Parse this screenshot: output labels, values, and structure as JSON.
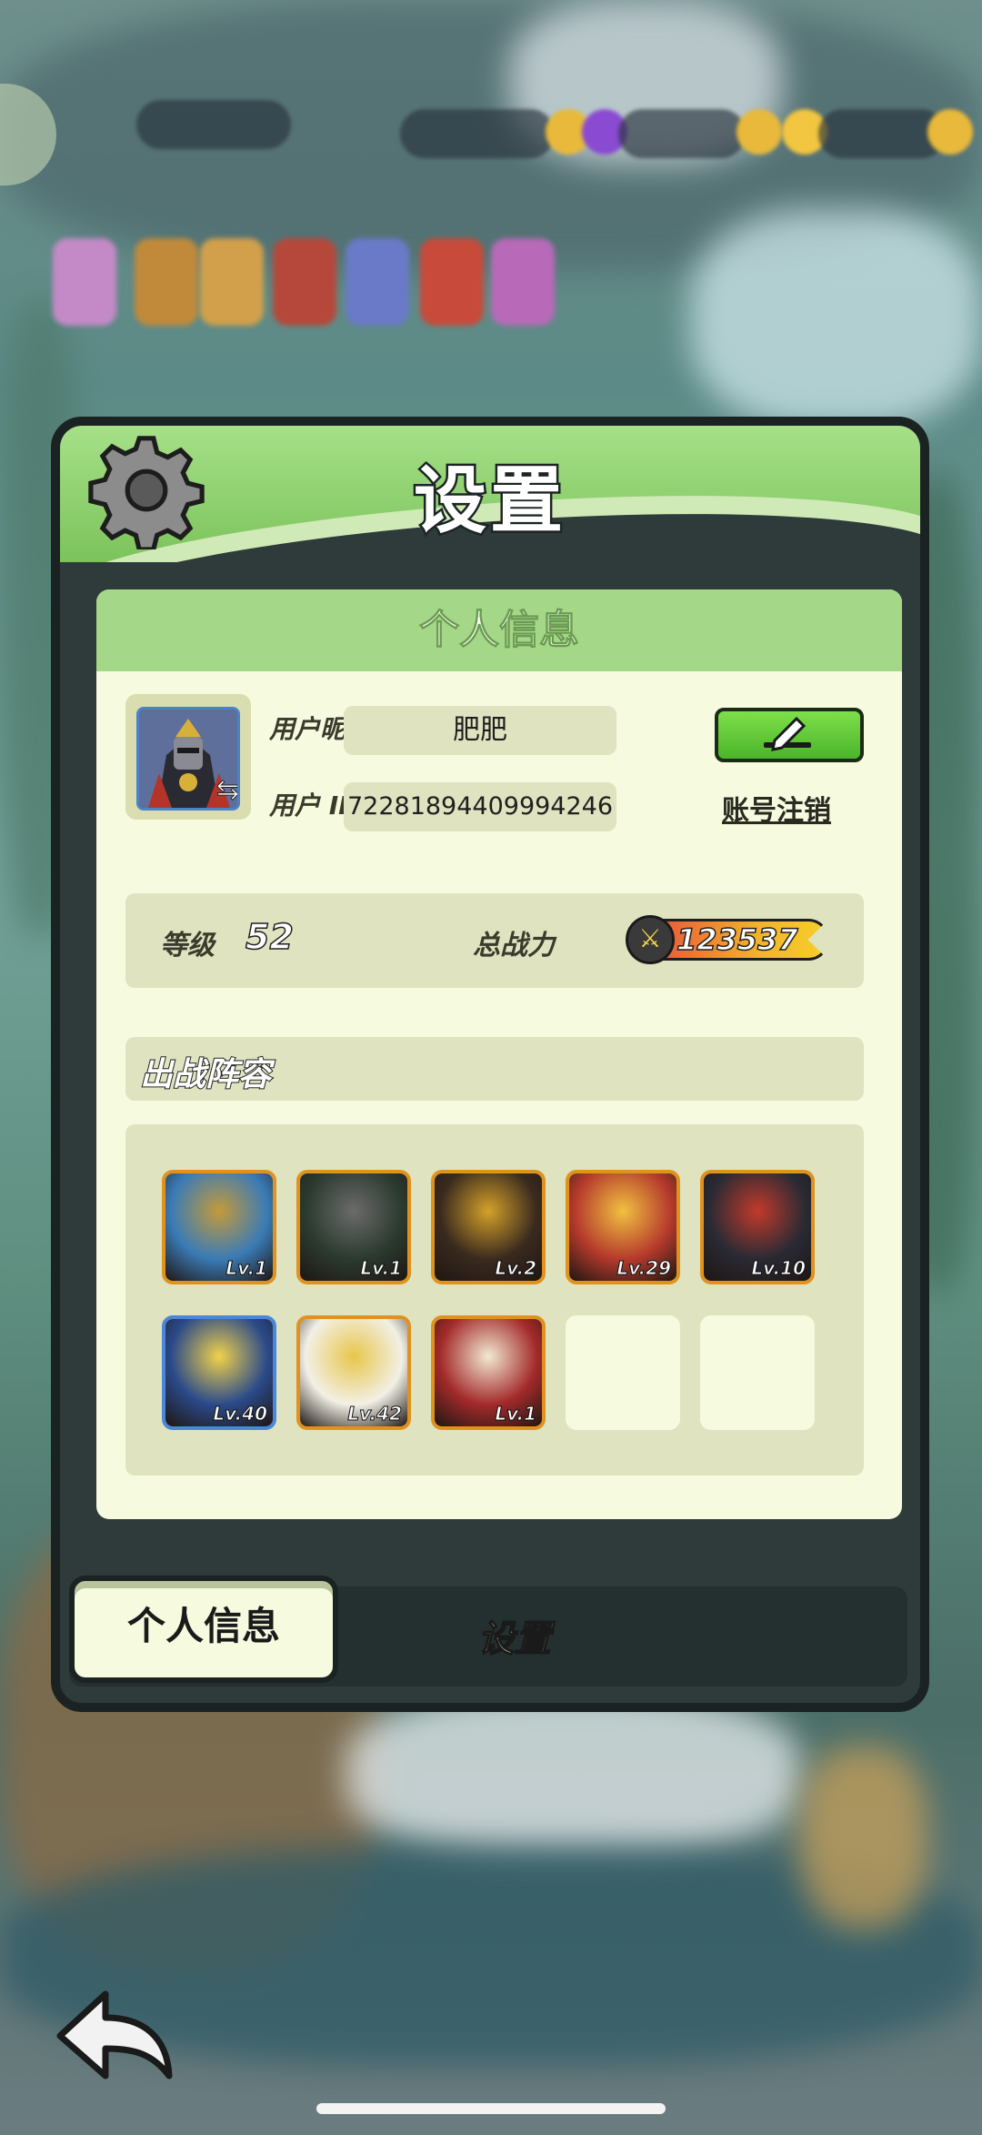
{
  "modal": {
    "title": "设置"
  },
  "profile": {
    "section_title": "个人信息",
    "nickname_label": "用户昵称",
    "nickname": "肥肥",
    "id_label": "用户 ID",
    "user_id": "72281894409994246",
    "account_cancel": "账号注销",
    "level_label": "等级",
    "level": "52",
    "power_label": "总战力",
    "power": "123537"
  },
  "lineup": {
    "title": "出战阵容",
    "heroes": [
      {
        "level": "Lv.1",
        "frame": "orange",
        "color_a": "#3a7bb6",
        "color_b": "#c49a3a"
      },
      {
        "level": "Lv.1",
        "frame": "orange",
        "color_a": "#2b3a2f",
        "color_b": "#6b6b6b"
      },
      {
        "level": "Lv.2",
        "frame": "orange",
        "color_a": "#3a2a1e",
        "color_b": "#d4a12a"
      },
      {
        "level": "Lv.29",
        "frame": "orange",
        "color_a": "#b53a2c",
        "color_b": "#f1c040"
      },
      {
        "level": "Lv.10",
        "frame": "orange",
        "color_a": "#2a2a34",
        "color_b": "#c23a2a"
      },
      {
        "level": "Lv.40",
        "frame": "blue",
        "color_a": "#2b4a8a",
        "color_b": "#f0d24a"
      },
      {
        "level": "Lv.42",
        "frame": "orange",
        "color_a": "#f2f0e6",
        "color_b": "#e8c64a"
      },
      {
        "level": "Lv.1",
        "frame": "orange",
        "color_a": "#a32a2a",
        "color_b": "#f1e9d2"
      }
    ],
    "empty_slots": 2
  },
  "tabs": {
    "active": "个人信息",
    "inactive": "设置"
  },
  "icons": {
    "gear": "gear-icon",
    "edit": "pencil-icon",
    "power": "crossed-swords-icon",
    "swap": "swap-icon",
    "back": "back-arrow-icon"
  }
}
